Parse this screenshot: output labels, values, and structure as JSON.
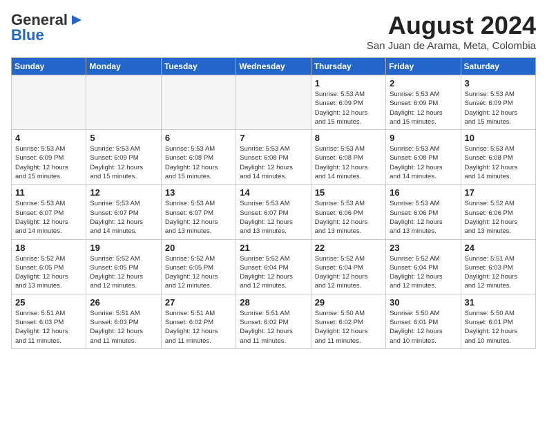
{
  "logo": {
    "general": "General",
    "blue": "Blue",
    "icon": "▶"
  },
  "title": "August 2024",
  "location": "San Juan de Arama, Meta, Colombia",
  "days_of_week": [
    "Sunday",
    "Monday",
    "Tuesday",
    "Wednesday",
    "Thursday",
    "Friday",
    "Saturday"
  ],
  "weeks": [
    [
      {
        "day": "",
        "info": ""
      },
      {
        "day": "",
        "info": ""
      },
      {
        "day": "",
        "info": ""
      },
      {
        "day": "",
        "info": ""
      },
      {
        "day": "1",
        "info": "Sunrise: 5:53 AM\nSunset: 6:09 PM\nDaylight: 12 hours\nand 15 minutes."
      },
      {
        "day": "2",
        "info": "Sunrise: 5:53 AM\nSunset: 6:09 PM\nDaylight: 12 hours\nand 15 minutes."
      },
      {
        "day": "3",
        "info": "Sunrise: 5:53 AM\nSunset: 6:09 PM\nDaylight: 12 hours\nand 15 minutes."
      }
    ],
    [
      {
        "day": "4",
        "info": "Sunrise: 5:53 AM\nSunset: 6:09 PM\nDaylight: 12 hours\nand 15 minutes."
      },
      {
        "day": "5",
        "info": "Sunrise: 5:53 AM\nSunset: 6:09 PM\nDaylight: 12 hours\nand 15 minutes."
      },
      {
        "day": "6",
        "info": "Sunrise: 5:53 AM\nSunset: 6:08 PM\nDaylight: 12 hours\nand 15 minutes."
      },
      {
        "day": "7",
        "info": "Sunrise: 5:53 AM\nSunset: 6:08 PM\nDaylight: 12 hours\nand 14 minutes."
      },
      {
        "day": "8",
        "info": "Sunrise: 5:53 AM\nSunset: 6:08 PM\nDaylight: 12 hours\nand 14 minutes."
      },
      {
        "day": "9",
        "info": "Sunrise: 5:53 AM\nSunset: 6:08 PM\nDaylight: 12 hours\nand 14 minutes."
      },
      {
        "day": "10",
        "info": "Sunrise: 5:53 AM\nSunset: 6:08 PM\nDaylight: 12 hours\nand 14 minutes."
      }
    ],
    [
      {
        "day": "11",
        "info": "Sunrise: 5:53 AM\nSunset: 6:07 PM\nDaylight: 12 hours\nand 14 minutes."
      },
      {
        "day": "12",
        "info": "Sunrise: 5:53 AM\nSunset: 6:07 PM\nDaylight: 12 hours\nand 14 minutes."
      },
      {
        "day": "13",
        "info": "Sunrise: 5:53 AM\nSunset: 6:07 PM\nDaylight: 12 hours\nand 13 minutes."
      },
      {
        "day": "14",
        "info": "Sunrise: 5:53 AM\nSunset: 6:07 PM\nDaylight: 12 hours\nand 13 minutes."
      },
      {
        "day": "15",
        "info": "Sunrise: 5:53 AM\nSunset: 6:06 PM\nDaylight: 12 hours\nand 13 minutes."
      },
      {
        "day": "16",
        "info": "Sunrise: 5:53 AM\nSunset: 6:06 PM\nDaylight: 12 hours\nand 13 minutes."
      },
      {
        "day": "17",
        "info": "Sunrise: 5:52 AM\nSunset: 6:06 PM\nDaylight: 12 hours\nand 13 minutes."
      }
    ],
    [
      {
        "day": "18",
        "info": "Sunrise: 5:52 AM\nSunset: 6:05 PM\nDaylight: 12 hours\nand 13 minutes."
      },
      {
        "day": "19",
        "info": "Sunrise: 5:52 AM\nSunset: 6:05 PM\nDaylight: 12 hours\nand 12 minutes."
      },
      {
        "day": "20",
        "info": "Sunrise: 5:52 AM\nSunset: 6:05 PM\nDaylight: 12 hours\nand 12 minutes."
      },
      {
        "day": "21",
        "info": "Sunrise: 5:52 AM\nSunset: 6:04 PM\nDaylight: 12 hours\nand 12 minutes."
      },
      {
        "day": "22",
        "info": "Sunrise: 5:52 AM\nSunset: 6:04 PM\nDaylight: 12 hours\nand 12 minutes."
      },
      {
        "day": "23",
        "info": "Sunrise: 5:52 AM\nSunset: 6:04 PM\nDaylight: 12 hours\nand 12 minutes."
      },
      {
        "day": "24",
        "info": "Sunrise: 5:51 AM\nSunset: 6:03 PM\nDaylight: 12 hours\nand 12 minutes."
      }
    ],
    [
      {
        "day": "25",
        "info": "Sunrise: 5:51 AM\nSunset: 6:03 PM\nDaylight: 12 hours\nand 11 minutes."
      },
      {
        "day": "26",
        "info": "Sunrise: 5:51 AM\nSunset: 6:03 PM\nDaylight: 12 hours\nand 11 minutes."
      },
      {
        "day": "27",
        "info": "Sunrise: 5:51 AM\nSunset: 6:02 PM\nDaylight: 12 hours\nand 11 minutes."
      },
      {
        "day": "28",
        "info": "Sunrise: 5:51 AM\nSunset: 6:02 PM\nDaylight: 12 hours\nand 11 minutes."
      },
      {
        "day": "29",
        "info": "Sunrise: 5:50 AM\nSunset: 6:02 PM\nDaylight: 12 hours\nand 11 minutes."
      },
      {
        "day": "30",
        "info": "Sunrise: 5:50 AM\nSunset: 6:01 PM\nDaylight: 12 hours\nand 10 minutes."
      },
      {
        "day": "31",
        "info": "Sunrise: 5:50 AM\nSunset: 6:01 PM\nDaylight: 12 hours\nand 10 minutes."
      }
    ]
  ]
}
